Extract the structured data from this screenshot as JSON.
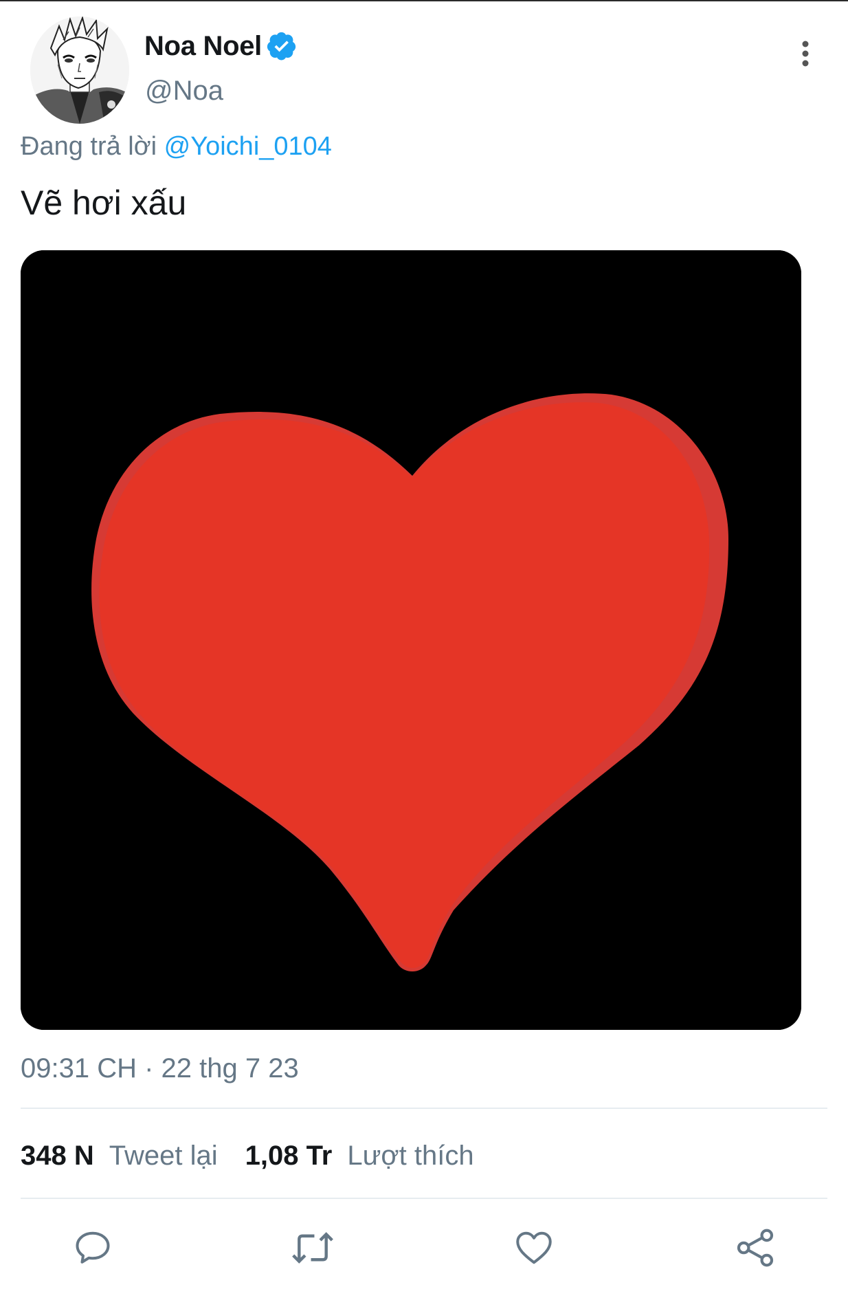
{
  "author": {
    "display_name": "Noa Noel",
    "handle": "@Noa",
    "verified_icon": "verified-badge-icon",
    "verified_color": "#1da1f2"
  },
  "reply": {
    "prefix": "Đang trả lời",
    "mention": "@Yoichi_0104"
  },
  "tweet": {
    "text": "Vẽ hơi xấu",
    "media_icon": "red-heart-drawing",
    "timestamp": "09:31 CH · 22 thg 7 23"
  },
  "stats": {
    "retweets_count": "348 N",
    "retweets_label": "Tweet lại",
    "likes_count": "1,08 Tr",
    "likes_label": "Lượt thích"
  },
  "actions": {
    "reply_icon": "reply-icon",
    "retweet_icon": "retweet-icon",
    "like_icon": "heart-icon",
    "share_icon": "share-icon"
  },
  "colors": {
    "accent": "#1da1f2",
    "secondary_text": "#657786",
    "heart_fill": "#e53526",
    "media_background": "#000000"
  }
}
